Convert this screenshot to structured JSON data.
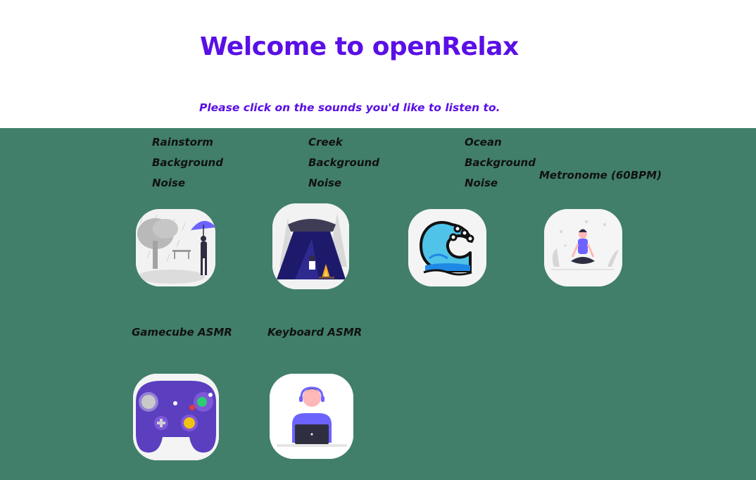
{
  "header": {
    "title": "Welcome to openRelax",
    "subtitle": "Please click on the sounds you'd like to listen to."
  },
  "sounds": [
    {
      "label_lines": [
        "Rainstorm",
        "Background",
        "Noise"
      ],
      "icon": "rainstorm-icon"
    },
    {
      "label_lines": [
        "Creek",
        "Background",
        "Noise"
      ],
      "icon": "creek-tent-icon"
    },
    {
      "label_lines": [
        "Ocean",
        "Background",
        "Noise"
      ],
      "icon": "ocean-wave-icon"
    },
    {
      "label": "Metronome (60BPM)",
      "icon": "meditation-icon"
    },
    {
      "label": "Gamecube ASMR",
      "icon": "gamecube-controller-icon"
    },
    {
      "label": "Keyboard ASMR",
      "icon": "person-laptop-icon"
    }
  ],
  "colors": {
    "accent": "#5a0fe6",
    "panel_background": "#417f6b",
    "label_text": "#111111"
  }
}
